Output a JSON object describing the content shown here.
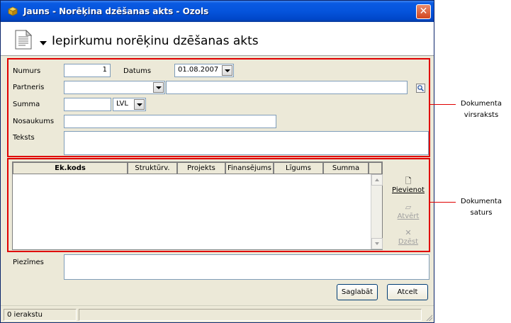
{
  "window": {
    "title": "Jauns - Norēķina dzēšanas akts - Ozols"
  },
  "header": {
    "title": "Iepirkumu norēķinu dzēšanas akts"
  },
  "fields": {
    "numurs_label": "Numurs",
    "numurs_value": "1",
    "datums_label": "Datums",
    "datums_value": "01.08.2007",
    "partneris_label": "Partneris",
    "partneris_value": "",
    "partneris_name_value": "",
    "summa_label": "Summa",
    "summa_value": "",
    "currency_value": "LVL",
    "nosaukums_label": "Nosaukums",
    "nosaukums_value": "",
    "teksts_label": "Teksts",
    "teksts_value": ""
  },
  "grid": {
    "columns": [
      "Ek.kods",
      "Struktūrv.",
      "Projekts",
      "Finansējums",
      "Līgums",
      "Summa"
    ]
  },
  "grid_buttons": {
    "add": "Pievienot",
    "open": "Atvērt",
    "delete": "Dzēst"
  },
  "notes": {
    "label": "Piezīmes",
    "value": ""
  },
  "buttons": {
    "save": "Saglabāt",
    "cancel": "Atcelt"
  },
  "status": {
    "records": "0 ierakstu"
  },
  "annotations": {
    "header_top": "Dokumenta",
    "header_bottom": "virsraksts",
    "content_top": "Dokumenta",
    "content_bottom": "saturs"
  },
  "colors": {
    "annotation": "#e00000",
    "titlebar": "#0554dc",
    "window_bg": "#ece9d8"
  }
}
